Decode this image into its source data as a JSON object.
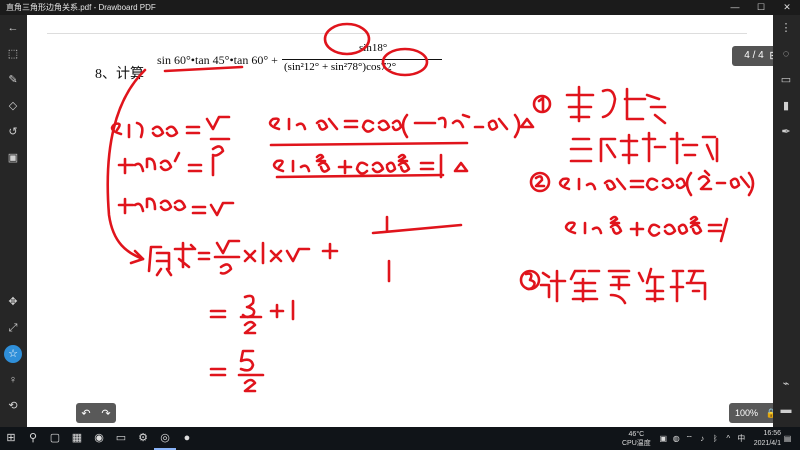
{
  "window": {
    "title": "直角三角形边角关系.pdf - Drawboard PDF",
    "controls": [
      "—",
      "☐",
      "✕"
    ]
  },
  "left_rail": {
    "icons": [
      "back-icon",
      "select-icon",
      "pen-icon",
      "eraser-icon",
      "history-icon",
      "save-icon",
      "move-icon",
      "fit-icon",
      "favorite-icon",
      "person-icon",
      "undo-alt-icon"
    ]
  },
  "right_rail": {
    "icons": [
      "share-icon",
      "comment-icon",
      "highlighter-icon",
      "marker-icon",
      "pen-tool-icon",
      "brush-icon",
      "grid-icon",
      "settings-icon"
    ]
  },
  "document": {
    "question_label": "8、计算",
    "formula_text": "sin 60°•tan 45°•tan 60° +",
    "fraction_numerator": "sin18°",
    "fraction_denominator": "(sin²12° + sin²78°)cos72°",
    "page_indicator": "4 / 4",
    "zoom": "100%"
  },
  "taskbar": {
    "temperature": "46°C",
    "temperature_label": "CPU温度",
    "time": "16:56",
    "date": "2021/4/1"
  },
  "ink_color": "#e0141c"
}
